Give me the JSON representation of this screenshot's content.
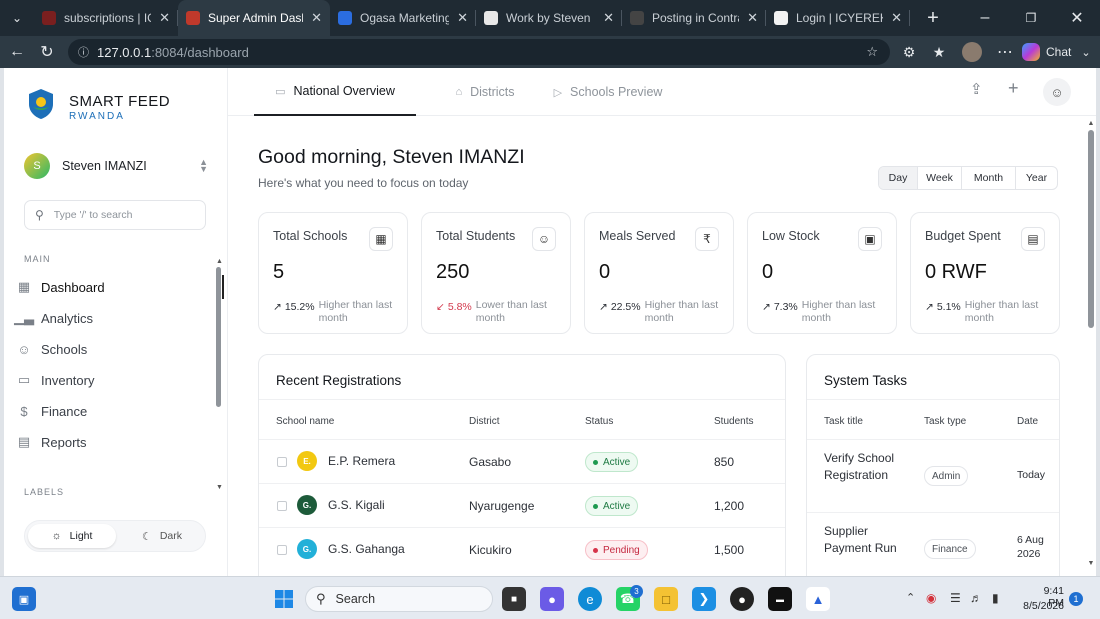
{
  "browser": {
    "tabs": [
      {
        "title": "subscriptions | ICYEREKEZO",
        "color": "#7a1f1f"
      },
      {
        "title": "Super Admin Dashboard",
        "color": "#c0392b",
        "active": true
      },
      {
        "title": "Ogasa Marketing Strategy",
        "color": "#2b6de0"
      },
      {
        "title": "Work by Steven IMANZI",
        "color": "#e8e8e8"
      },
      {
        "title": "Posting in Contra Portfolio",
        "color": "#444"
      },
      {
        "title": "Login | ICYEREKEZO Global",
        "color": "#f2f2f2"
      }
    ],
    "url_host": "127.0.0.1",
    "url_rest": ":8084/dashboard",
    "chat_label": "Chat"
  },
  "sidebar": {
    "brand_name": "SMART FEED",
    "brand_sub": "RWANDA",
    "user_initial": "S",
    "user_name": "Steven IMANZI",
    "search_placeholder": "Type '/' to search",
    "main_label": "MAIN",
    "labels_label": "LABELS",
    "items": [
      {
        "label": "Dashboard",
        "icon": "grid-icon"
      },
      {
        "label": "Analytics",
        "icon": "bar-chart-icon"
      },
      {
        "label": "Schools",
        "icon": "users-icon"
      },
      {
        "label": "Inventory",
        "icon": "folder-icon"
      },
      {
        "label": "Finance",
        "icon": "dollar-icon"
      },
      {
        "label": "Reports",
        "icon": "document-icon"
      }
    ],
    "theme_light": "Light",
    "theme_dark": "Dark"
  },
  "topnav": {
    "tabs": [
      "National Overview",
      "Districts",
      "Schools Preview"
    ]
  },
  "header": {
    "greeting": "Good morning, Steven IMANZI",
    "subtitle": "Here's what you need to focus on today",
    "periods": [
      "Day",
      "Week",
      "Month",
      "Year"
    ],
    "selected_period": "Day"
  },
  "stats": [
    {
      "title": "Total Schools",
      "value": "5",
      "change": "15.2%",
      "note": "Higher than last month",
      "up": true,
      "icon": "building-icon"
    },
    {
      "title": "Total Students",
      "value": "250",
      "change": "5.8%",
      "note": "Lower than last month",
      "up": false,
      "icon": "users-icon"
    },
    {
      "title": "Meals Served",
      "value": "0",
      "change": "22.5%",
      "note": "Higher than last month",
      "up": true,
      "icon": "coin-icon"
    },
    {
      "title": "Low Stock",
      "value": "0",
      "change": "7.3%",
      "note": "Higher than last month",
      "up": true,
      "icon": "archive-icon"
    },
    {
      "title": "Budget Spent",
      "value": "0 RWF",
      "change": "5.1%",
      "note": "Higher than last month",
      "up": true,
      "icon": "money-icon"
    }
  ],
  "registrations": {
    "title": "Recent Registrations",
    "columns": [
      "School name",
      "District",
      "Status",
      "Students"
    ],
    "rows": [
      {
        "initial": "E.",
        "color": "#f2c811",
        "name": "E.P. Remera",
        "district": "Gasabo",
        "status": "Active",
        "students": "850"
      },
      {
        "initial": "G.",
        "color": "#1d5b3a",
        "name": "G.S. Kigali",
        "district": "Nyarugenge",
        "status": "Active",
        "students": "1,200"
      },
      {
        "initial": "G.",
        "color": "#22b0d8",
        "name": "G.S. Gahanga",
        "district": "Kicukiro",
        "status": "Pending",
        "students": "1,500"
      }
    ]
  },
  "tasks": {
    "title": "System Tasks",
    "columns": [
      "Task title",
      "Task type",
      "Date"
    ],
    "rows": [
      {
        "title": "Verify School Registration",
        "type": "Admin",
        "date": "Today"
      },
      {
        "title": "Supplier Payment Run",
        "type": "Finance",
        "date": "6 Aug 2026"
      }
    ]
  },
  "taskbar": {
    "search_label": "Search",
    "time": "9:41 PM",
    "date": "8/5/2026",
    "whatsapp_badge": "3",
    "notif_count": "1"
  }
}
